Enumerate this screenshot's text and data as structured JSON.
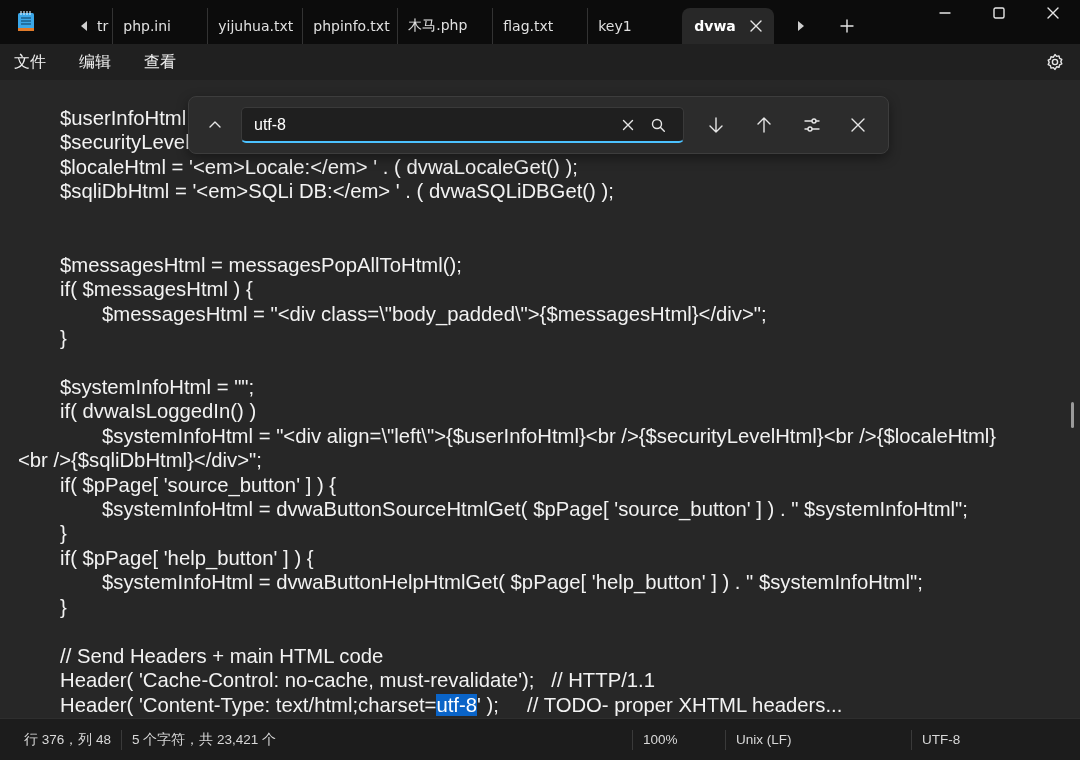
{
  "tabs": [
    {
      "label": "tr",
      "selected": false
    },
    {
      "label": "php.ini",
      "selected": false
    },
    {
      "label": "yijuhua.txt",
      "selected": false
    },
    {
      "label": "phpinfo.txt",
      "selected": false
    },
    {
      "label": "木马.php",
      "selected": false
    },
    {
      "label": "flag.txt",
      "selected": false
    },
    {
      "label": "key1",
      "selected": false
    },
    {
      "label": "dvwa",
      "selected": true
    }
  ],
  "menu": [
    "文件",
    "编辑",
    "查看"
  ],
  "find": {
    "value": "utf-8"
  },
  "lines": [
    {
      "kind": "plain",
      "text": "\t$userInfoHtml"
    },
    {
      "kind": "plain",
      "text": "\t$securityLevel"
    },
    {
      "kind": "plain",
      "text": "\t$localeHtml = '<em>Locale:</em> ' . ( dvwaLocaleGet() );"
    },
    {
      "kind": "plain",
      "text": "\t$sqliDbHtml = '<em>SQLi DB:</em> ' . ( dvwaSQLiDBGet() );"
    },
    {
      "kind": "blank"
    },
    {
      "kind": "blank"
    },
    {
      "kind": "plain",
      "text": "\t$messagesHtml = messagesPopAllToHtml();"
    },
    {
      "kind": "plain",
      "text": "\tif( $messagesHtml ) {"
    },
    {
      "kind": "plain",
      "text": "\t\t$messagesHtml = \"<div class=\\\"body_padded\\\">{$messagesHtml}</div>\";"
    },
    {
      "kind": "plain",
      "text": "\t}"
    },
    {
      "kind": "blank"
    },
    {
      "kind": "plain",
      "text": "\t$systemInfoHtml = \"\";"
    },
    {
      "kind": "plain",
      "text": "\tif( dvwaIsLoggedIn() )"
    },
    {
      "kind": "plain",
      "text": "\t\t$systemInfoHtml = \"<div align=\\\"left\\\">{$userInfoHtml}<br />{$securityLevelHtml}<br />{$localeHtml}"
    },
    {
      "kind": "plain",
      "text": "<br />{$sqliDbHtml}</div>\";"
    },
    {
      "kind": "plain",
      "text": "\tif( $pPage[ 'source_button' ] ) {"
    },
    {
      "kind": "plain",
      "text": "\t\t$systemInfoHtml = dvwaButtonSourceHtmlGet( $pPage[ 'source_button' ] ) . \" $systemInfoHtml\";"
    },
    {
      "kind": "plain",
      "text": "\t}"
    },
    {
      "kind": "plain",
      "text": "\tif( $pPage[ 'help_button' ] ) {"
    },
    {
      "kind": "plain",
      "text": "\t\t$systemInfoHtml = dvwaButtonHelpHtmlGet( $pPage[ 'help_button' ] ) . \" $systemInfoHtml\";"
    },
    {
      "kind": "plain",
      "text": "\t}"
    },
    {
      "kind": "blank"
    },
    {
      "kind": "plain",
      "text": "\t// Send Headers + main HTML code"
    },
    {
      "kind": "plain",
      "text": "\tHeader( 'Cache-Control: no-cache, must-revalidate');   // HTTP/1.1"
    },
    {
      "kind": "match",
      "before": "\tHeader( 'Content-Type: text/html;charset=",
      "match": "utf-8",
      "after": "' );     // TODO- proper XHTML headers..."
    }
  ],
  "status": {
    "position": "行 376，列 48",
    "count": "5 个字符，共 23,421 个",
    "zoom": "100%",
    "line_ending": "Unix (LF)",
    "encoding": "UTF-8"
  }
}
